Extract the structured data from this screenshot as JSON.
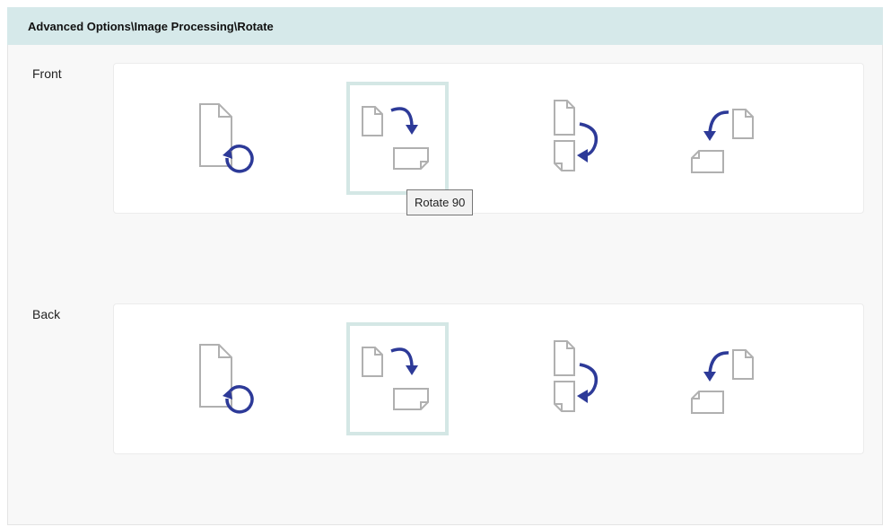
{
  "header": {
    "title": "Advanced Options\\Image Processing\\Rotate"
  },
  "front": {
    "label": "Front",
    "selected": "rotate-90",
    "options": [
      {
        "name": "rotate-auto",
        "icon": "rotate-auto-icon"
      },
      {
        "name": "rotate-90",
        "icon": "rotate-90-icon"
      },
      {
        "name": "rotate-180",
        "icon": "rotate-180-icon"
      },
      {
        "name": "rotate-270",
        "icon": "rotate-270-icon"
      }
    ]
  },
  "back": {
    "label": "Back",
    "selected": "rotate-90",
    "options": [
      {
        "name": "rotate-auto",
        "icon": "rotate-auto-icon"
      },
      {
        "name": "rotate-90",
        "icon": "rotate-90-icon"
      },
      {
        "name": "rotate-180",
        "icon": "rotate-180-icon"
      },
      {
        "name": "rotate-270",
        "icon": "rotate-270-icon"
      }
    ]
  },
  "tooltip": {
    "text": "Rotate 90"
  },
  "colors": {
    "header_bg": "#d6e9ea",
    "selection_border": "#d4e7e5",
    "page_outline": "#b0b0b0",
    "arrow": "#2d3a98"
  }
}
